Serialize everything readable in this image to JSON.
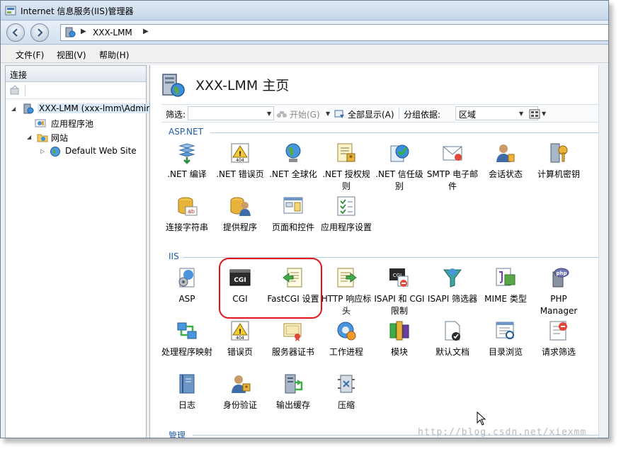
{
  "window": {
    "title": "Internet 信息服务(IIS)管理器"
  },
  "address": {
    "crumb": "XXX-LMM"
  },
  "menu": [
    {
      "label": "文件(F)"
    },
    {
      "label": "视图(V)"
    },
    {
      "label": "帮助(H)"
    }
  ],
  "connections": {
    "header": "连接",
    "tree": [
      {
        "label": "XXX-LMM (xxx-lmm\\Admir",
        "icon": "server-icon",
        "expander": "◢"
      },
      {
        "label": "应用程序池",
        "icon": "app-pool-icon",
        "expander": ""
      },
      {
        "label": "网站",
        "icon": "sites-folder-icon",
        "expander": "◢"
      },
      {
        "label": "Default Web Site",
        "icon": "globe-icon",
        "expander": "▷"
      }
    ]
  },
  "main": {
    "title": "XXX-LMM 主页",
    "filter": {
      "label": "筛选:",
      "start_label": "开始(G)",
      "show_all_label": "全部显示(A)",
      "group_label": "分组依据:",
      "group_value": "区域"
    },
    "sections": {
      "aspnet": "ASP.NET",
      "iis": "IIS",
      "management": "管理"
    },
    "aspnet_features": [
      {
        "label": ".NET 编译",
        "icon": "compile-icon"
      },
      {
        "label": ".NET 错误页",
        "icon": "error-page-icon"
      },
      {
        "label": ".NET 全球化",
        "icon": "globalization-icon"
      },
      {
        "label": ".NET 授权规则",
        "icon": "authorization-icon"
      },
      {
        "label": ".NET 信任级别",
        "icon": "trust-level-icon"
      },
      {
        "label": "SMTP 电子邮件",
        "icon": "smtp-icon"
      },
      {
        "label": "会话状态",
        "icon": "session-state-icon"
      },
      {
        "label": "计算机密钥",
        "icon": "machine-key-icon"
      },
      {
        "label": "连接字符串",
        "icon": "connection-strings-icon"
      },
      {
        "label": "提供程序",
        "icon": "providers-icon"
      },
      {
        "label": "页面和控件",
        "icon": "pages-controls-icon"
      },
      {
        "label": "应用程序设置",
        "icon": "app-settings-icon"
      }
    ],
    "iis_features": [
      {
        "label": "ASP",
        "icon": "asp-icon"
      },
      {
        "label": "CGI",
        "icon": "cgi-icon"
      },
      {
        "label": "FastCGI 设置",
        "icon": "fastcgi-icon"
      },
      {
        "label": "HTTP 响应标头",
        "icon": "http-headers-icon"
      },
      {
        "label": "ISAPI 和 CGI 限制",
        "icon": "isapi-cgi-icon"
      },
      {
        "label": "ISAPI 筛选器",
        "icon": "isapi-filters-icon"
      },
      {
        "label": "MIME 类型",
        "icon": "mime-types-icon"
      },
      {
        "label": "PHP Manager",
        "icon": "php-icon"
      },
      {
        "label": "处理程序映射",
        "icon": "handler-mappings-icon"
      },
      {
        "label": "错误页",
        "icon": "error-page-icon"
      },
      {
        "label": "服务器证书",
        "icon": "certificates-icon"
      },
      {
        "label": "工作进程",
        "icon": "worker-processes-icon"
      },
      {
        "label": "模块",
        "icon": "modules-icon"
      },
      {
        "label": "默认文档",
        "icon": "default-document-icon"
      },
      {
        "label": "目录浏览",
        "icon": "directory-browsing-icon"
      },
      {
        "label": "请求筛选",
        "icon": "request-filtering-icon"
      },
      {
        "label": "日志",
        "icon": "logging-icon"
      },
      {
        "label": "身份验证",
        "icon": "authentication-icon"
      },
      {
        "label": "输出缓存",
        "icon": "output-caching-icon"
      },
      {
        "label": "压缩",
        "icon": "compression-icon"
      }
    ]
  },
  "watermark": "http://blog.csdn.net/xiexmm"
}
